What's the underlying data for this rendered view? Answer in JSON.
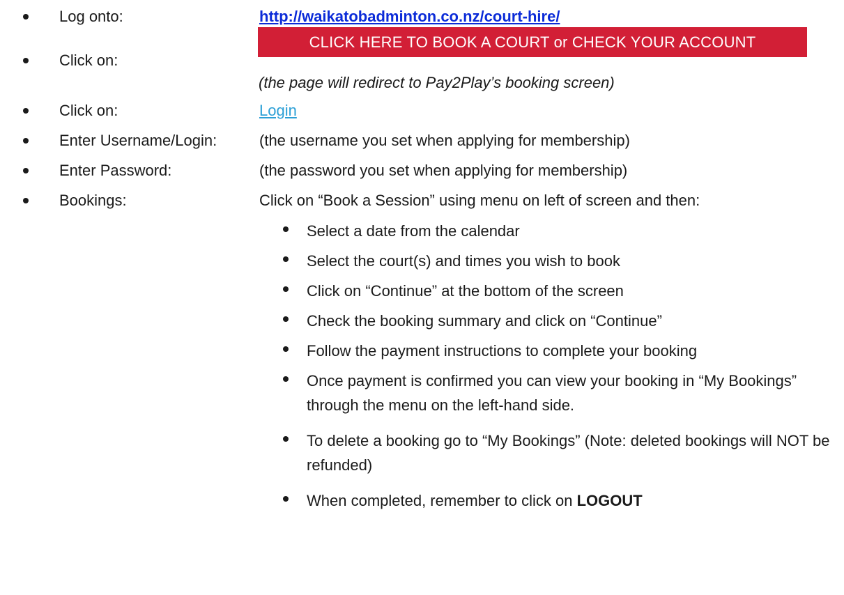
{
  "steps": [
    {
      "label": "Log onto:",
      "value": "http://waikatobadminton.co.nz/court-hire/"
    },
    {
      "label": "Click on:",
      "button": "CLICK HERE TO BOOK A COURT or CHECK YOUR ACCOUNT",
      "note": "(the page will redirect to Pay2Play’s booking screen)"
    },
    {
      "label": "Click on:",
      "value": "Login"
    },
    {
      "label": "Enter Username/Login:",
      "value": "(the username you set when applying for membership)"
    },
    {
      "label": "Enter Password:",
      "value": "(the password you set when applying for membership)"
    },
    {
      "label": "Bookings:",
      "value": "Click on “Book a Session” using menu on left of screen and then:"
    }
  ],
  "booking_substeps": [
    "Select a date from the calendar",
    "Select the court(s) and times you wish to book",
    "Click on “Continue” at the bottom of the screen",
    "Check the booking summary and click on “Continue”",
    "Follow the payment instructions to complete your booking",
    "Once payment is confirmed you can view your booking in “My Bookings” through the menu on the left-hand side.",
    "To delete a booking go to “My Bookings” (Note: deleted bookings will NOT be refunded)"
  ],
  "final_step": {
    "prefix": "When completed, remember to click on ",
    "emphasis": "LOGOUT"
  },
  "colors": {
    "button_bg": "#d21f36",
    "url_link": "#0b2bd8",
    "login_link": "#2b9fd6"
  }
}
